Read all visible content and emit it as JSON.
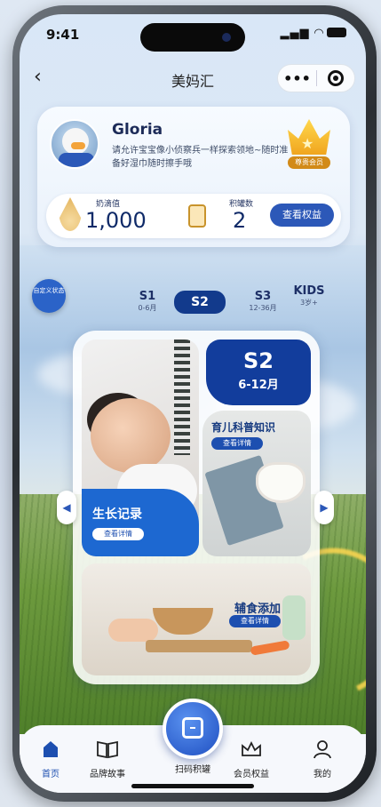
{
  "status": {
    "time": "9:41"
  },
  "navbar": {
    "title": "美妈汇",
    "more": "•••"
  },
  "profile": {
    "name": "Gloria",
    "slogan": "请允许宝宝像小侦察兵一样探索领地~随时准备好湿巾随时擦手哦",
    "badge": "尊贵会员",
    "milk_label": "奶滴值",
    "milk_value": "1,000",
    "cans_label": "积罐数",
    "cans_value": "2",
    "view_benefits": "查看权益"
  },
  "stages": {
    "custom_label": "自定义状态",
    "items": [
      {
        "main": "S1",
        "sub": "0-6月"
      },
      {
        "main": "S2",
        "sub": ""
      },
      {
        "main": "S3",
        "sub": "12-36月"
      },
      {
        "main": "KIDS",
        "sub": "3岁+"
      }
    ]
  },
  "panel": {
    "stage_big": "S2",
    "stage_range": "6-12月",
    "science_title": "育儿科普知识",
    "growth_title": "生长记录",
    "food_title": "辅食添加",
    "details": "查看详情"
  },
  "tabbar": {
    "home": "首页",
    "story": "品牌故事",
    "scan": "扫码积罐",
    "member": "会员权益",
    "mine": "我的"
  },
  "colors": {
    "brand_blue": "#2c58b8",
    "dark_blue": "#123d9c"
  }
}
